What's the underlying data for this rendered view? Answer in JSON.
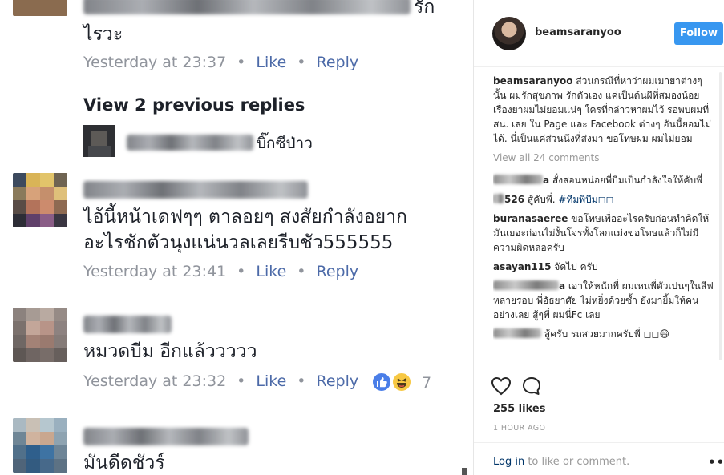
{
  "facebook": {
    "comments": [
      {
        "text_lines": [
          "รัก",
          "ไรวะ"
        ],
        "time": "Yesterday at 23:37",
        "like": "Like",
        "reply": "Reply"
      },
      {
        "view_previous": "View 2 previous replies"
      },
      {
        "reply_snippet": "บิ๊กซีป่าว"
      },
      {
        "text_lines": [
          "ไอ้นี้หน้าเดฟๆๆ ตาลอยๆ สงสัยกำลังอยาก",
          "อะไรชักตัวนุงแน่นวลเลยรีบชัว555555"
        ],
        "time": "Yesterday at 23:41",
        "like": "Like",
        "reply": "Reply"
      },
      {
        "text_lines": [
          "หมวดบีม อีกแล้ววววว"
        ],
        "time": "Yesterday at 23:32",
        "like": "Like",
        "reply": "Reply",
        "reaction_count": "7"
      },
      {
        "text_lines": [
          "มันดีดชัวร์"
        ]
      }
    ]
  },
  "instagram": {
    "username": "beamsaranyoo",
    "follow_label": "Follow",
    "caption": {
      "user": "beamsaranyoo",
      "text": " ส่วนกรณีที่หาว่าผมเมายาต่างๆ นั้น ผมรักสุขภาพ รักตัวเอง แค่เป็นต้นผีที่สมองน้อย เรื่องยาผมไม่ยอมแน่ๆ ใครที่กล่าวหาผมไว้ รอพบผมที่สน. เลย ใน Page และ Facebook ต่างๆ อันนี้ยอมไม่ได้. นี่เป็นแค่ส่วนนึงที่ส่งมา ขอโทษผม ผมไม่ยอม"
    },
    "view_all": "View all 24 comments",
    "comments": [
      {
        "user_suffix": "a",
        "text": " สั่งสอนหน่อยพี่บีมเป็นกำลังใจให้คับพี่"
      },
      {
        "user_suffix": "526",
        "text": " สู้คับพี่. ",
        "tag": "#ทีมพี่บีม◻◻"
      },
      {
        "user": "buranasaeree",
        "text": " ขอโทษเพื่ออะไรครับก่อนทำคิดให้มันเยอะก่อนไม่งั้นโจรทั้งโลกแม่งขอโทษแล้วก็ไม่มีความผิดหลอครับ"
      },
      {
        "user_prefix": "asayan115",
        "text": " จัดไป ครับ"
      },
      {
        "user_suffix": "a",
        "text": " เอาให้หนักพี่ ผมเหนพี่ตัวเปนๆในลีฟหลายรอบ พี่อัธยาศัย ไม่หยิ่งด้วยซ้ำ ยังมายิ้มให้คนอย่างเลย สู้ๆพี่ ผมนี่Fc เลย"
      },
      {
        "user_suffix": "",
        "text": " สู้ครับ รถสวยมากครับพี่ ◻◻😄"
      }
    ],
    "likes": "255 likes",
    "time": "1 HOUR AGO",
    "login_link": "Log in",
    "login_rest": " to like or comment.",
    "more": "•••"
  }
}
